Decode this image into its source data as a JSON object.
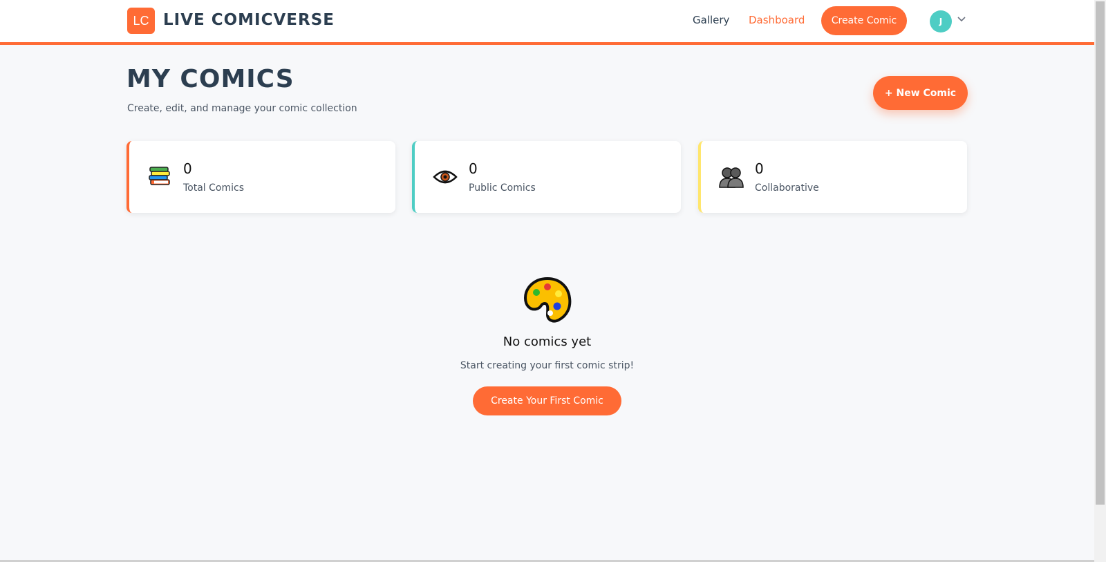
{
  "header": {
    "logo_initials": "LC",
    "brand": "Live Comicverse",
    "nav": {
      "gallery": "Gallery",
      "dashboard": "Dashboard"
    },
    "create_button": "Create Comic",
    "avatar_initial": "J",
    "chevron": "⌵"
  },
  "page": {
    "title": "My Comics",
    "subtitle": "Create, edit, and manage your comic collection",
    "new_button": "+ New Comic"
  },
  "stats": [
    {
      "value": "0",
      "label": "Total Comics",
      "icon": "books-icon"
    },
    {
      "value": "0",
      "label": "Public Comics",
      "icon": "eye-icon"
    },
    {
      "value": "0",
      "label": "Collaborative",
      "icon": "people-icon"
    }
  ],
  "empty_state": {
    "icon": "palette-icon",
    "title": "No comics yet",
    "text": "Start creating your first comic strip!",
    "button": "Create Your First Comic"
  },
  "colors": {
    "accent": "#ff6b35",
    "teal": "#4ecdc4",
    "yellow": "#ffe66d",
    "heading": "#2c3e50"
  }
}
